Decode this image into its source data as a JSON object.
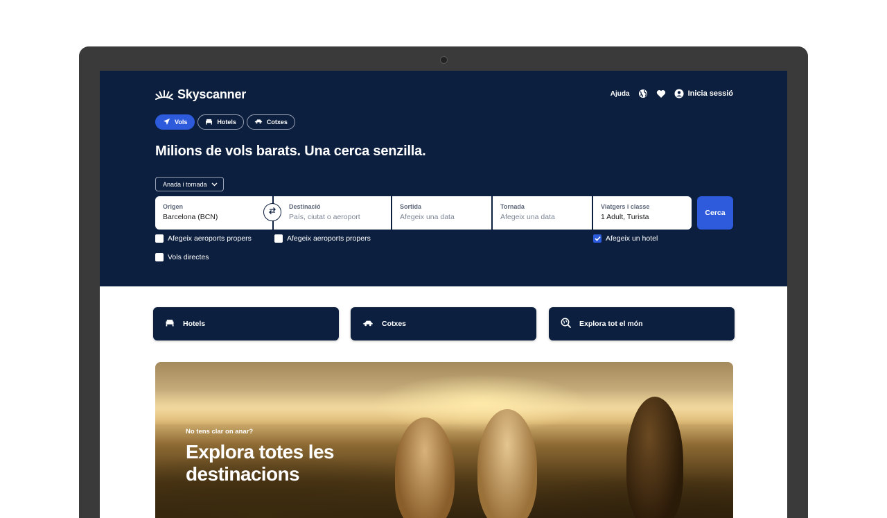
{
  "brand": {
    "name": "Skyscanner"
  },
  "header": {
    "help": "Ajuda",
    "login": "Inicia sessió"
  },
  "tabs": [
    {
      "label": "Vols",
      "active": true
    },
    {
      "label": "Hotels",
      "active": false
    },
    {
      "label": "Cotxes",
      "active": false
    }
  ],
  "hero": {
    "headline": "Milions de vols barats. Una cerca senzilla."
  },
  "search": {
    "trip_type": "Anada i tornada",
    "origin": {
      "label": "Origen",
      "value": "Barcelona (BCN)"
    },
    "destination": {
      "label": "Destinació",
      "placeholder": "País, ciutat o aeroport"
    },
    "departure": {
      "label": "Sortida",
      "placeholder": "Afegeix una data"
    },
    "return": {
      "label": "Tornada",
      "placeholder": "Afegeix una data"
    },
    "travellers": {
      "label": "Viatgers i classe",
      "value": "1 Adult, Turista"
    },
    "button": "Cerca",
    "options": {
      "nearby_origin": {
        "label": "Afegeix aeroports propers",
        "checked": false
      },
      "nearby_destination": {
        "label": "Afegeix aeroports propers",
        "checked": false
      },
      "add_hotel": {
        "label": "Afegeix un hotel",
        "checked": true
      },
      "direct": {
        "label": "Vols directes",
        "checked": false
      }
    }
  },
  "quick_links": [
    {
      "label": "Hotels",
      "icon": "bed-icon"
    },
    {
      "label": "Cotxes",
      "icon": "car-icon"
    },
    {
      "label": "Explora tot el món",
      "icon": "explore-icon"
    }
  ],
  "banner": {
    "kicker": "No tens clar on anar?",
    "title": "Explora totes les destinacions"
  },
  "colors": {
    "navy": "#0c1f3f",
    "accent": "#2d5bdc"
  }
}
